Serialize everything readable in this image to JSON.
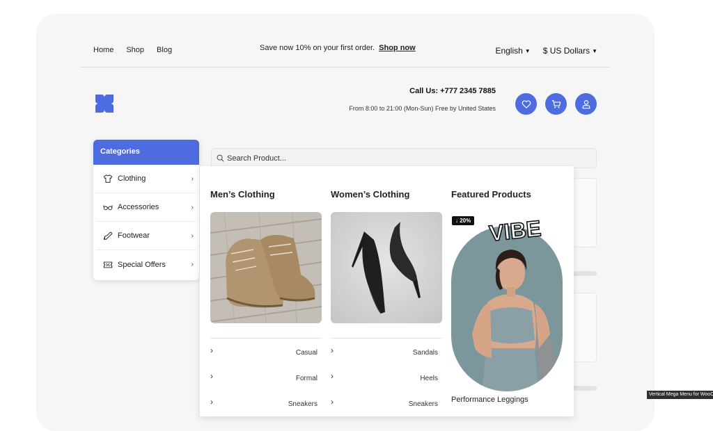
{
  "topnav": {
    "links": [
      "Home",
      "Shop",
      "Blog"
    ]
  },
  "promo": {
    "text": "Save now 10% on your first order.",
    "link": "Shop now"
  },
  "selectors": {
    "language": "English",
    "currency": "$ US Dollars"
  },
  "contact": {
    "call": "Call Us: +777 2345 7885",
    "hours": "From 8:00 to 21:00 (Mon-Sun) Free by United States"
  },
  "header_icons": [
    "heart-icon",
    "cart-icon",
    "user-icon"
  ],
  "categories": {
    "title": "Categories",
    "items": [
      {
        "label": "Clothing",
        "icon": "tshirt-icon"
      },
      {
        "label": "Accessories",
        "icon": "glasses-icon"
      },
      {
        "label": "Footwear",
        "icon": "heel-icon"
      },
      {
        "label": "Special Offers",
        "icon": "ticket-icon"
      }
    ]
  },
  "search": {
    "placeholder": "Search Product..."
  },
  "mega_menu": {
    "mens": {
      "title": "Men’s Clothing",
      "links": [
        "Casual",
        "Formal",
        "Sneakers"
      ]
    },
    "womens": {
      "title": "Women’s Clothing",
      "links": [
        "Sandals",
        "Heels",
        "Sneakers"
      ]
    },
    "featured": {
      "title": "Featured Products",
      "badge": "↓ 20%",
      "brand": "VIBE",
      "product": "Performance Leggings"
    }
  },
  "tooltip": "Vertical Mega Menu for WooCommerce",
  "colors": {
    "accent": "#4c6ce0",
    "teal": "#7b979c"
  }
}
